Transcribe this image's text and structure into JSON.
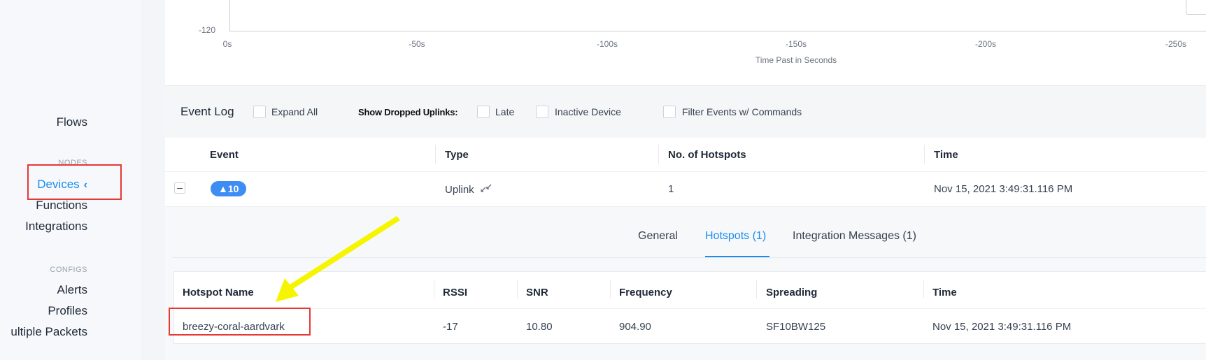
{
  "sidebar": {
    "items": {
      "flows": "Flows",
      "devices": "Devices",
      "functions": "Functions",
      "integrations": "Integrations",
      "alerts": "Alerts",
      "profiles": "Profiles",
      "multiple_packets": "ultiple Packets"
    },
    "sections": {
      "nodes": "NODES",
      "configs": "CONFIGS"
    },
    "chevron": "‹"
  },
  "chart_data": {
    "type": "line",
    "ylabel_tick": "-120",
    "x_ticks": [
      "0s",
      "-50s",
      "-100s",
      "-150s",
      "-200s",
      "-250s"
    ],
    "xlabel": "Time Past in Seconds"
  },
  "event_log": {
    "title": "Event Log",
    "expand_all": "Expand All",
    "show_dropped": "Show Dropped Uplinks:",
    "late": "Late",
    "inactive_device": "Inactive Device",
    "filter_commands": "Filter Events w/ Commands"
  },
  "event_table": {
    "headers": [
      "Event",
      "Type",
      "No. of Hotspots",
      "Time"
    ],
    "row": {
      "toggle": "–",
      "event_badge": "▲10",
      "type": "Uplink",
      "hotspots": "1",
      "time": "Nov 15, 2021 3:49:31.116 PM"
    }
  },
  "detail_tabs": {
    "general": "General",
    "hotspots": "Hotspots (1)",
    "integration_messages": "Integration Messages (1)"
  },
  "hotspot_table": {
    "headers": [
      "Hotspot Name",
      "RSSI",
      "SNR",
      "Frequency",
      "Spreading",
      "Time"
    ],
    "row": {
      "name": "breezy-coral-aardvark",
      "rssi": "-17",
      "snr": "10.80",
      "frequency": "904.90",
      "spreading": "SF10BW125",
      "time": "Nov 15, 2021 3:49:31.116 PM"
    }
  },
  "colors": {
    "accent": "#1a8cf0",
    "annotation_red": "#e53935",
    "annotation_arrow": "#f5f500"
  }
}
